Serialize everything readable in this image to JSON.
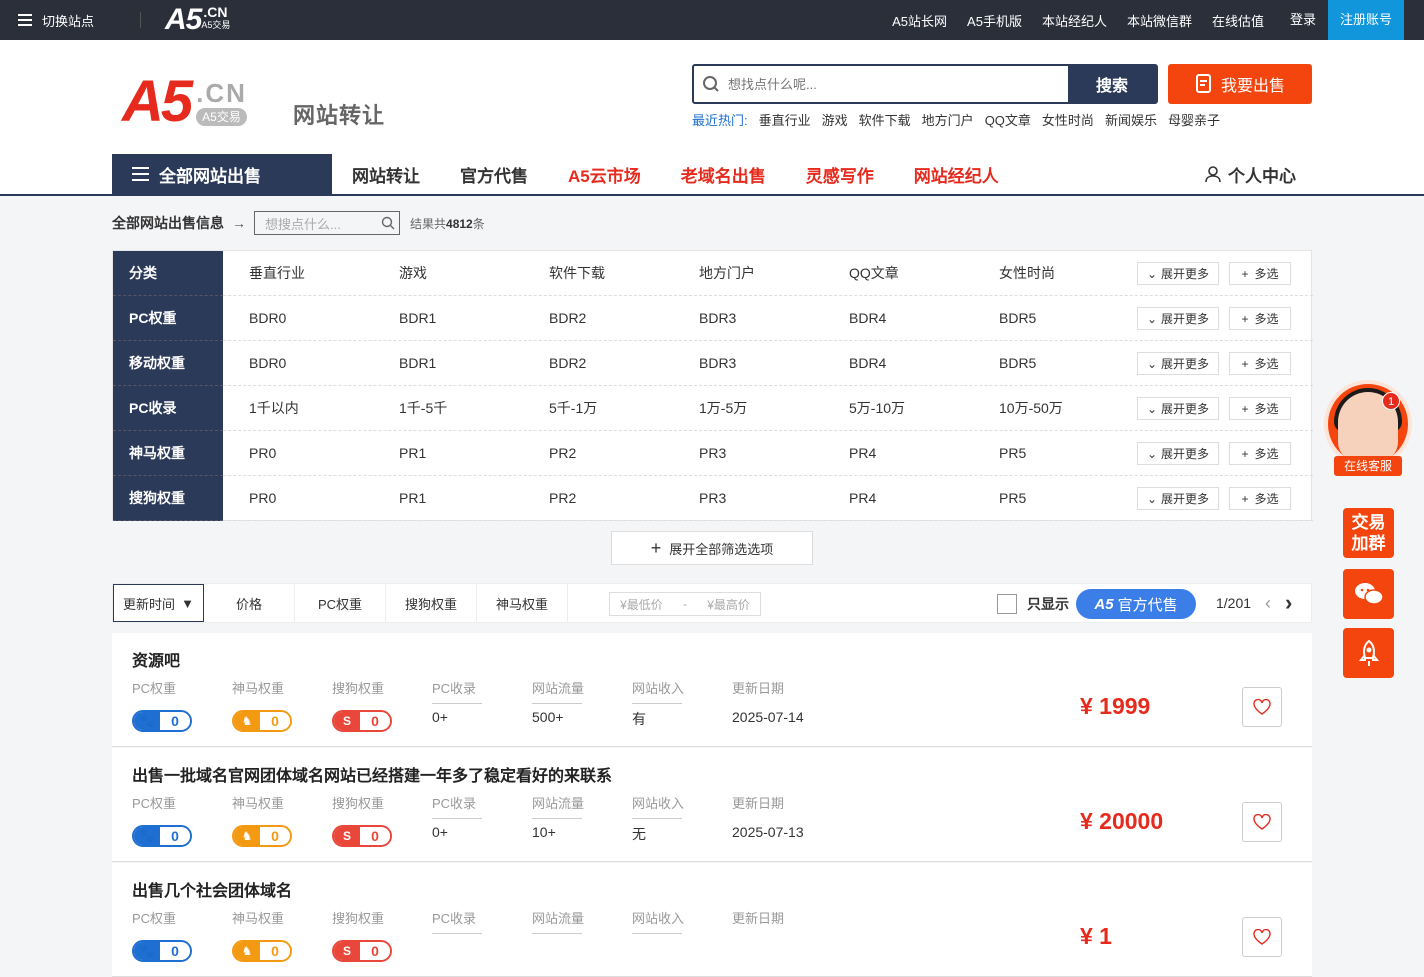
{
  "topbar": {
    "switch_label": "切换站点",
    "logo_a5": "A5",
    "logo_cn": ".CN",
    "logo_sub": "A5交易",
    "links": [
      "A5站长网",
      "A5手机版",
      "本站经纪人",
      "本站微信群",
      "在线估值"
    ],
    "login": "登录",
    "register": "注册账号"
  },
  "header": {
    "logo_a5": "A5",
    "logo_cn": ".CN",
    "logo_badge": "A5交易",
    "logo_title": "网站转让",
    "search_placeholder": "想找点什么呢...",
    "search_button": "搜索",
    "sell_button": "我要出售",
    "hot_label": "最近热门:",
    "hot_items": [
      "垂直行业",
      "游戏",
      "软件下载",
      "地方门户",
      "QQ文章",
      "女性时尚",
      "新闻娱乐",
      "母婴亲子"
    ]
  },
  "nav": {
    "all_label": "全部网站出售",
    "items": [
      {
        "label": "网站转让",
        "color": "dark"
      },
      {
        "label": "官方代售",
        "color": "dark"
      },
      {
        "label": "A5云市场",
        "color": "red"
      },
      {
        "label": "老域名出售",
        "color": "red"
      },
      {
        "label": "灵感写作",
        "color": "red"
      },
      {
        "label": "网站经纪人",
        "color": "red"
      }
    ],
    "user_center": "个人中心"
  },
  "crumb": {
    "title": "全部网站出售信息",
    "search_placeholder": "想搜点什么...",
    "result_prefix": "结果共",
    "result_count": "4812",
    "result_suffix": "条"
  },
  "filters": [
    {
      "label": "分类",
      "options": [
        "垂直行业",
        "游戏",
        "软件下载",
        "地方门户",
        "QQ文章",
        "女性时尚"
      ]
    },
    {
      "label": "PC权重",
      "options": [
        "BDR0",
        "BDR1",
        "BDR2",
        "BDR3",
        "BDR4",
        "BDR5"
      ]
    },
    {
      "label": "移动权重",
      "options": [
        "BDR0",
        "BDR1",
        "BDR2",
        "BDR3",
        "BDR4",
        "BDR5"
      ]
    },
    {
      "label": "PC收录",
      "options": [
        "1千以内",
        "1千-5千",
        "5千-1万",
        "1万-5万",
        "5万-10万",
        "10万-50万"
      ]
    },
    {
      "label": "神马权重",
      "options": [
        "PR0",
        "PR1",
        "PR2",
        "PR3",
        "PR4",
        "PR5"
      ]
    },
    {
      "label": "搜狗权重",
      "options": [
        "PR0",
        "PR1",
        "PR2",
        "PR3",
        "PR4",
        "PR5"
      ]
    }
  ],
  "filter_more": "展开更多",
  "filter_multi": "多选",
  "expand_all": "展开全部筛选选项",
  "sortbar": {
    "items": [
      "更新时间",
      "价格",
      "PC权重",
      "搜狗权重",
      "神马权重"
    ],
    "price_min": "¥最低价",
    "price_dash": "-",
    "price_max": "¥最高价",
    "only_show": "只显示",
    "official_logo": "A5",
    "official_text": "官方代售",
    "page": "1/201"
  },
  "columns": [
    "PC权重",
    "神马权重",
    "搜狗权重",
    "PC收录",
    "网站流量",
    "网站收入",
    "更新日期"
  ],
  "listings": [
    {
      "title": "资源吧",
      "pc": "0",
      "shenma": "0",
      "sogou": "0",
      "shoulu": "0+",
      "traffic": "500+",
      "income": "有",
      "date": "2025-07-14",
      "price": "¥  1999"
    },
    {
      "title": "出售一批域名官网团体域名网站已经搭建一年多了稳定看好的来联系",
      "pc": "0",
      "shenma": "0",
      "sogou": "0",
      "shoulu": "0+",
      "traffic": "10+",
      "income": "无",
      "date": "2025-07-13",
      "price": "¥  20000"
    },
    {
      "title": "出售几个社会团体域名",
      "pc": "0",
      "shenma": "0",
      "sogou": "0",
      "shoulu": "",
      "traffic": "",
      "income": "",
      "date": "",
      "price": "¥  1"
    }
  ],
  "float": {
    "service_label": "在线客服",
    "badge": "1",
    "group_line1": "交易",
    "group_line2": "加群"
  },
  "colors": {
    "navy": "#2c3a5a",
    "red": "#e62b1e",
    "orange": "#f5450e",
    "blue": "#1296db"
  }
}
